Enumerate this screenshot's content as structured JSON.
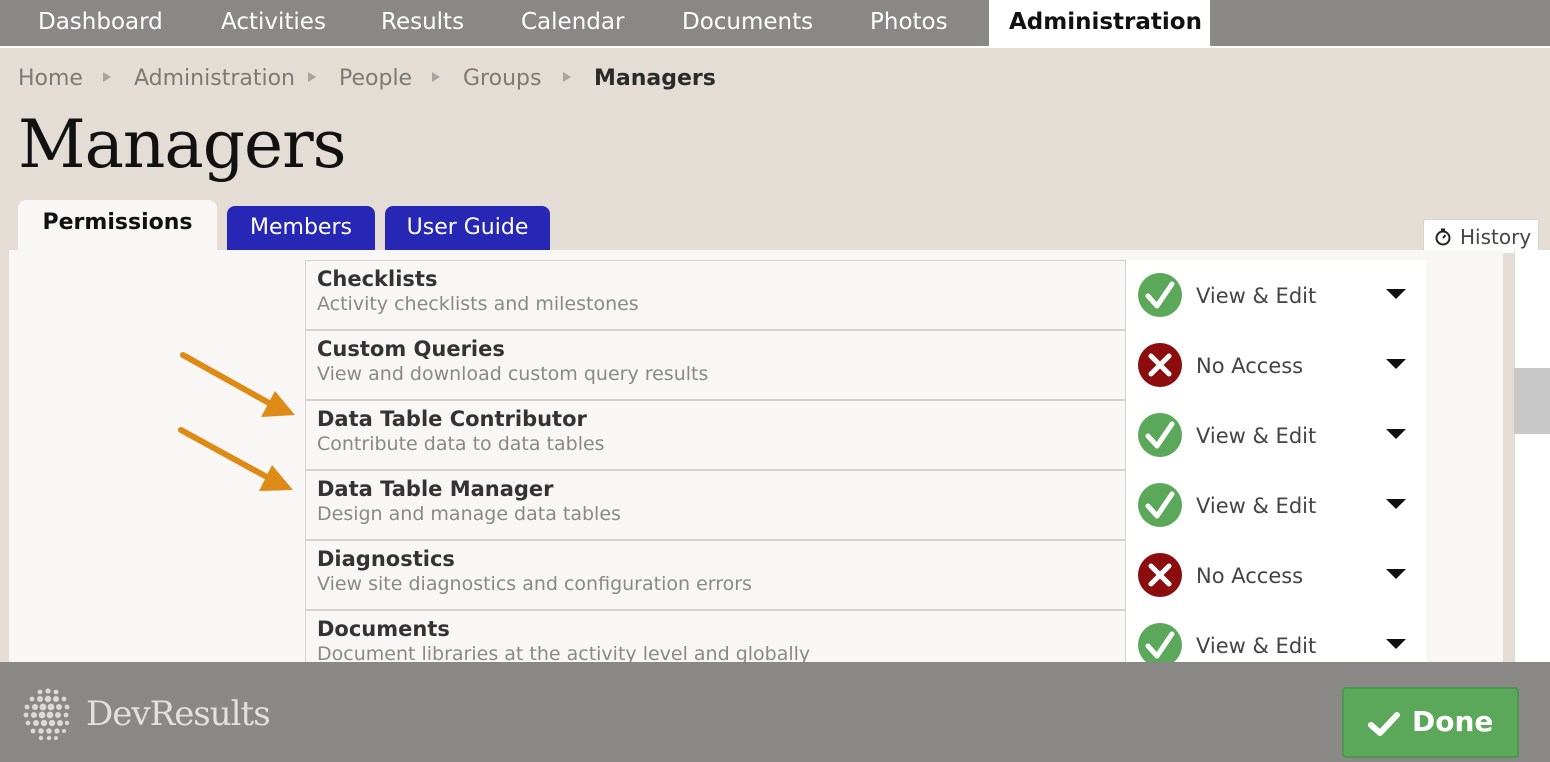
{
  "nav": {
    "items": [
      {
        "label": "Dashboard",
        "active": false
      },
      {
        "label": "Activities",
        "active": false
      },
      {
        "label": "Results",
        "active": false
      },
      {
        "label": "Calendar",
        "active": false
      },
      {
        "label": "Documents",
        "active": false
      },
      {
        "label": "Photos",
        "active": false
      },
      {
        "label": "Administration",
        "active": true
      }
    ]
  },
  "breadcrumb": [
    "Home",
    "Administration",
    "People",
    "Groups",
    "Managers"
  ],
  "page": {
    "title": "Managers"
  },
  "tabs": [
    {
      "label": "Permissions",
      "active": true
    },
    {
      "label": "Members",
      "active": false
    },
    {
      "label": "User Guide",
      "active": false
    }
  ],
  "history": {
    "label": "History",
    "icon": "stopwatch-icon"
  },
  "permissions": [
    {
      "name": "Checklists",
      "description": "Activity checklists and milestones",
      "access": "View & Edit",
      "status": "allowed"
    },
    {
      "name": "Custom Queries",
      "description": "View and download custom query results",
      "access": "No Access",
      "status": "denied"
    },
    {
      "name": "Data Table Contributor",
      "description": "Contribute data to data tables",
      "access": "View & Edit",
      "status": "allowed"
    },
    {
      "name": "Data Table Manager",
      "description": "Design and manage data tables",
      "access": "View & Edit",
      "status": "allowed"
    },
    {
      "name": "Diagnostics",
      "description": "View site diagnostics and configuration errors",
      "access": "No Access",
      "status": "denied"
    },
    {
      "name": "Documents",
      "description": "Document libraries at the activity level and globally",
      "access": "View & Edit",
      "status": "allowed"
    }
  ],
  "footer": {
    "logo_text": "DevResults",
    "done_label": "Done"
  },
  "colors": {
    "nav_bg": "#8a8886",
    "tab_blue": "#2628b5",
    "allowed": "#5ba85a",
    "denied": "#8b0d0d",
    "annotation_arrow": "#dd8a17"
  }
}
